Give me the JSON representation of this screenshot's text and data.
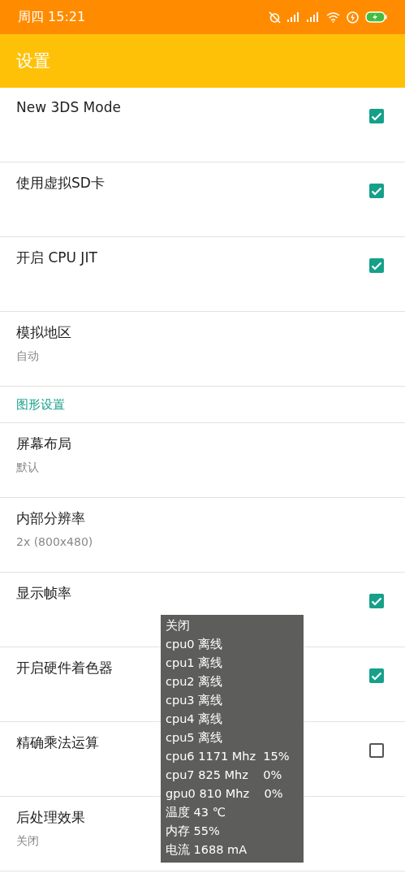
{
  "status_bar": {
    "time": "周四 15:21"
  },
  "app_bar": {
    "title": "设置"
  },
  "settings": [
    {
      "kind": "checkbox",
      "title": "New 3DS Mode",
      "checked": true
    },
    {
      "kind": "checkbox",
      "title": "使用虚拟SD卡",
      "checked": true
    },
    {
      "kind": "checkbox",
      "title": "开启 CPU JIT",
      "checked": true
    },
    {
      "kind": "value",
      "title": "模拟地区",
      "summary": "自动"
    },
    {
      "kind": "category",
      "title": "图形设置"
    },
    {
      "kind": "value",
      "title": "屏幕布局",
      "summary": "默认"
    },
    {
      "kind": "value",
      "title": "内部分辨率",
      "summary": "2x (800x480)"
    },
    {
      "kind": "checkbox",
      "title": "显示帧率",
      "checked": true
    },
    {
      "kind": "checkbox",
      "title": "开启硬件着色器",
      "checked": true
    },
    {
      "kind": "checkbox",
      "title": "精确乘法运算",
      "checked": false
    },
    {
      "kind": "value",
      "title": "后处理效果",
      "summary": "关闭"
    }
  ],
  "overlay": {
    "lines": [
      "关闭",
      "cpu0 离线",
      "cpu1 离线",
      "cpu2 离线",
      "cpu3 离线",
      "cpu4 离线",
      "cpu5 离线",
      "cpu6 1171 Mhz  15%",
      "cpu7 825 Mhz    0%",
      "gpu0 810 Mhz    0%",
      "温度 43 ℃",
      "内存 55%",
      "电流 1688 mA"
    ]
  }
}
